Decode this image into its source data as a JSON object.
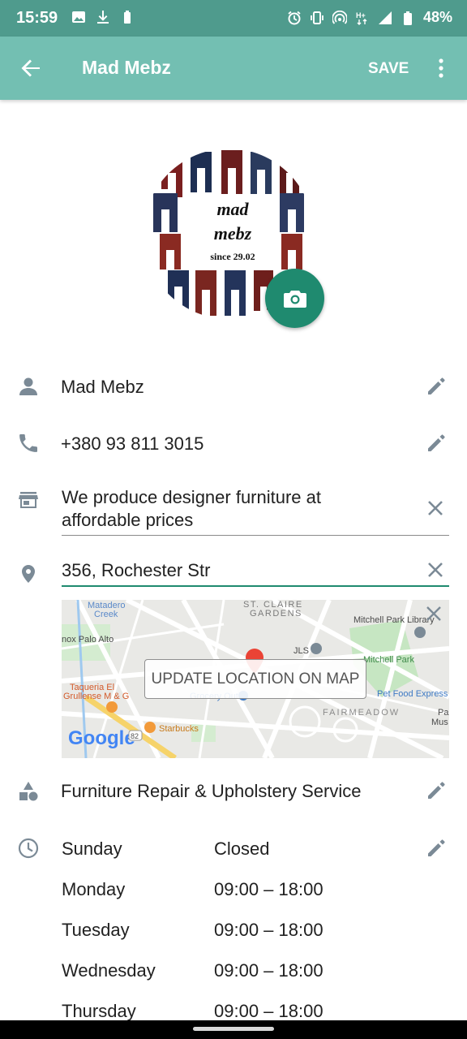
{
  "status_bar": {
    "time": "15:59",
    "battery": "48%",
    "left_icons": [
      "gallery-icon",
      "download-icon",
      "battery-saver-icon"
    ],
    "right_icons": [
      "alarm-icon",
      "vibrate-icon",
      "hotspot-icon",
      "network-h-plus-icon",
      "signal-icon",
      "battery-icon"
    ]
  },
  "app_bar": {
    "title": "Mad Mebz",
    "save_label": "SAVE",
    "back_icon": "arrow-back-icon",
    "more_icon": "more-vert-icon"
  },
  "profile": {
    "logo_text_line1": "mad",
    "logo_text_line2": "mebz",
    "logo_text_line3": "since 29.02",
    "camera_icon": "camera-icon"
  },
  "fields": {
    "name": {
      "value": "Mad Mebz",
      "icon": "person-icon"
    },
    "phone": {
      "value": "+380 93 811 3015",
      "icon": "phone-icon"
    },
    "description": {
      "line1": "We produce designer furniture at",
      "line2": "affordable prices",
      "icon": "store-icon"
    },
    "address": {
      "value": "356, Rochester Str",
      "icon": "location-pin-icon"
    },
    "category": {
      "value": "Furniture Repair & Upholstery Service",
      "icon": "category-icon"
    }
  },
  "map": {
    "button_label": "UPDATE LOCATION ON MAP",
    "labels": {
      "matadero": "Matadero",
      "creek": "Creek",
      "st_claire": "ST. CLAIRE",
      "gardens": "GARDENS",
      "library": "Mitchell Park Library",
      "palo_alto": "nox Palo Alto",
      "jls": "JLS",
      "mitchell_park": "Mitchell Park",
      "taqueria1": "Taqueria El",
      "taqueria2": "Grullense M & G",
      "pet_food": "Pet Food Express",
      "grocery": "Grocery Outlet",
      "fairmeadow": "FAIRMEADOW",
      "starbucks": "Starbucks",
      "palo2": "Pal",
      "museum": "Mus",
      "google": "Google",
      "road_82": "82"
    },
    "colors": {
      "park": "#c6e6c2",
      "road": "#ffffff",
      "highway": "#f6d36a",
      "pin": "#ea4335"
    }
  },
  "hours": {
    "icon": "clock-icon",
    "rows": [
      {
        "day": "Sunday",
        "time": "Closed"
      },
      {
        "day": "Monday",
        "time": "09:00 – 18:00"
      },
      {
        "day": "Tuesday",
        "time": "09:00 – 18:00"
      },
      {
        "day": "Wednesday",
        "time": "09:00 – 18:00"
      },
      {
        "day": "Thursday",
        "time": "09:00 – 18:00"
      }
    ]
  },
  "colors": {
    "accent": "#1f8a6f",
    "app_bar": "#73bfb2",
    "status_bar": "#4f9b8d",
    "icon_grey": "#7b8a96"
  }
}
